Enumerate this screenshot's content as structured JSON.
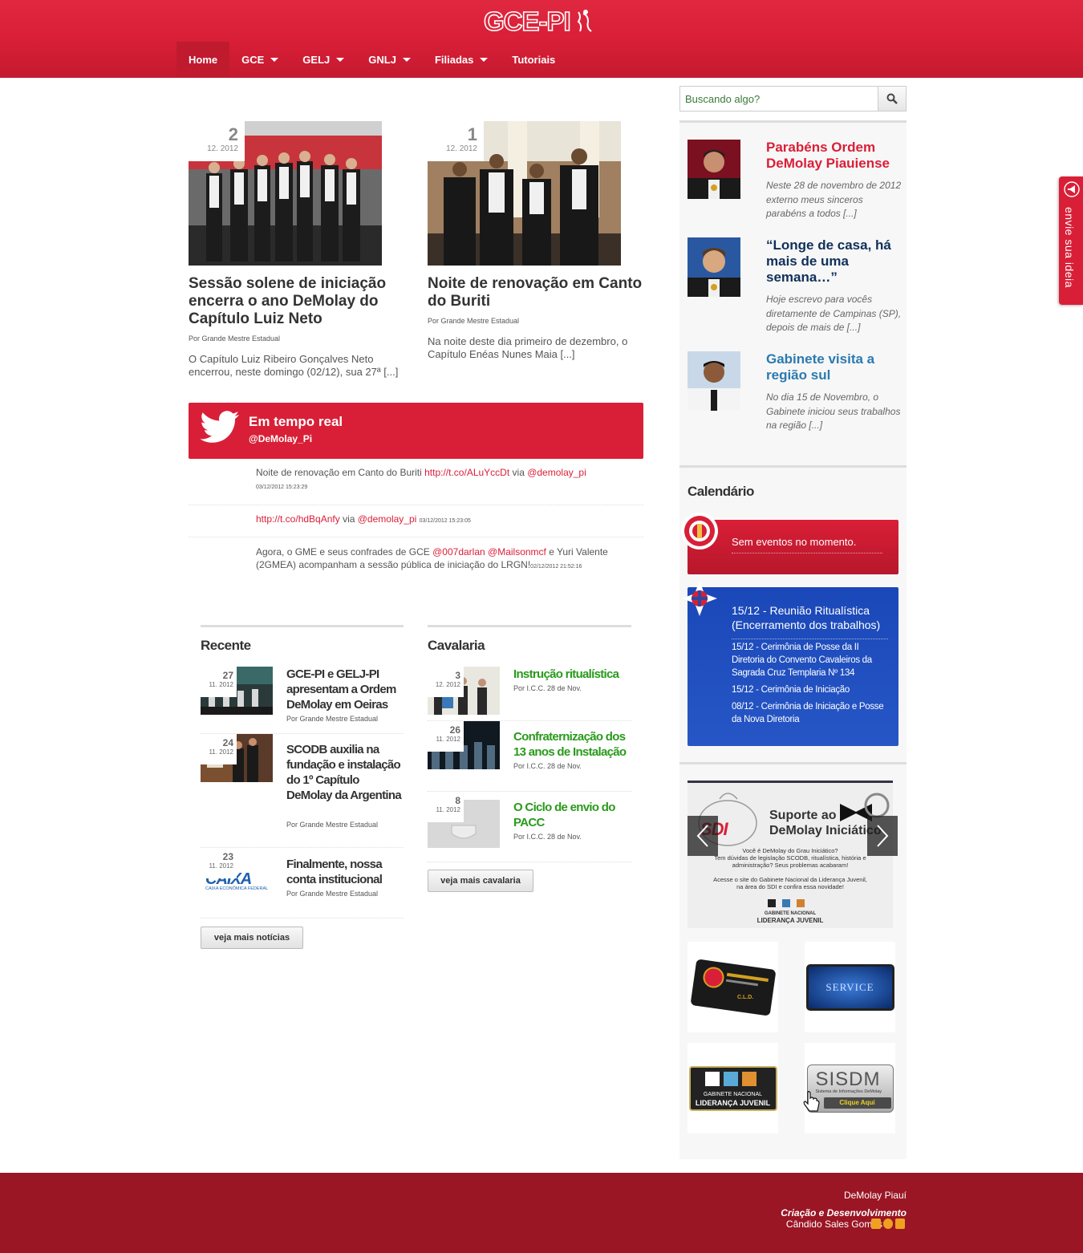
{
  "header": {
    "logo_text": "GCE-PI",
    "nav": [
      {
        "label": "Home",
        "active": true,
        "dropdown": false
      },
      {
        "label": "GCE",
        "dropdown": true
      },
      {
        "label": "GELJ",
        "dropdown": true
      },
      {
        "label": "GNLJ",
        "dropdown": true
      },
      {
        "label": "Filiadas",
        "dropdown": true
      },
      {
        "label": "Tutoriais",
        "dropdown": false
      }
    ]
  },
  "search": {
    "placeholder": "Buscando algo?",
    "button_icon": "search-icon"
  },
  "featured": [
    {
      "day": "2",
      "month": "12. 2012",
      "title": "Sessão solene de iniciação encerra o ano DeMolay do Capítulo Luiz Neto",
      "byline": "Por Grande Mestre Estadual",
      "excerpt": "O Capítulo Luiz Ribeiro Gonçalves Neto encerrou, neste domingo (02/12), sua 27ª [...]"
    },
    {
      "day": "1",
      "month": "12. 2012",
      "title": "Noite de renovação em Canto do Buriti",
      "byline": "Por Grande Mestre Estadual",
      "excerpt": "Na noite deste dia primeiro de dezembro, o Capítulo Enéas Nunes Maia [...]"
    }
  ],
  "twitter": {
    "title": "Em tempo real",
    "handle": "@DeMolay_Pi",
    "tweets": [
      {
        "text": "Noite de renovação em Canto do Buriti ",
        "link": "http://t.co/ALuYccDt",
        "via": " via ",
        "mention": "@demolay_pi",
        "extra": "",
        "extra_mention2": "",
        "text2": "",
        "time": "03/12/2012 15:23:29"
      },
      {
        "text": "",
        "link": "http://t.co/hdBqAnfy",
        "via": " via ",
        "mention": "@demolay_pi",
        "time": "03/12/2012 15:23:05"
      },
      {
        "text": "Agora, o GME e seus confrades de GCE ",
        "mention": "@007darlan",
        "mention2": "@Mailsonmcf",
        "text2": " e Yuri Valente (2GMEA) acompanham a sessão pública de iniciação do LRGN!",
        "time": "02/12/2012 21:52:16"
      }
    ]
  },
  "recente": {
    "title": "Recente",
    "items": [
      {
        "day": "27",
        "month": "11. 2012",
        "title": "GCE-PI e GELJ-PI apresentam a Ordem DeMolay em Oeiras",
        "byline": "Por Grande Mestre Estadual"
      },
      {
        "day": "24",
        "month": "11. 2012",
        "title": "SCODB auxilia na fundação e instalação do 1º Capítulo DeMolay da Argentina",
        "byline": "Por Grande Mestre Estadual"
      },
      {
        "day": "23",
        "month": "11. 2012",
        "title": "Finalmente, nossa conta institucional",
        "byline": "Por Grande Mestre Estadual",
        "thumb_text": "CAIXA",
        "thumb_sub": "CAIXA ECONÔMICA FEDERAL"
      }
    ],
    "more": "veja mais notícias"
  },
  "cavalaria": {
    "title": "Cavalaria",
    "items": [
      {
        "day": "3",
        "month": "12. 2012",
        "title": "Instrução ritualística",
        "byline": "Por I.C.C. 28 de Nov."
      },
      {
        "day": "26",
        "month": "11. 2012",
        "title": "Confraternização dos 13 anos de Instalação",
        "byline": "Por I.C.C. 28 de Nov."
      },
      {
        "day": "8",
        "month": "11. 2012",
        "title": "O Ciclo de envio do PACC",
        "byline": "Por I.C.C. 28 de Nov."
      }
    ],
    "more": "veja mais cavalaria"
  },
  "sidebar": {
    "posts": [
      {
        "title": "Parabéns Ordem DeMolay Piauiense",
        "excerpt": "Neste 28 de novembro de 2012 externo meus sinceros parabéns a todos [...]",
        "color": "#d91f37"
      },
      {
        "title": "“Longe de casa, há mais de uma semana…”",
        "excerpt": "Hoje escrevo para vocês diretamente de Campinas (SP), depois de mais de [...]",
        "color": "#10305a"
      },
      {
        "title": "Gabinete visita a região sul",
        "excerpt": "No dia 15 de Novembro, o Gabinete iniciou seus trabalhos na região [...]",
        "color": "#2a7ab0"
      }
    ],
    "calendar_title": "Calendário",
    "calendar_empty": "Sem eventos no momento.",
    "events": [
      "15/12 - Reunião Ritualística (Encerramento dos trabalhos)",
      "15/12 - Cerimônia de Posse da II Diretoria do Convento Cavaleiros da Sagrada Cruz Templaria Nº 134",
      "15/12 - Cerimônia de Iniciação",
      "08/12 - Cerimônia de Iniciação e Posse da Nova Diretoria"
    ],
    "banner": {
      "badge": "SDI",
      "headline1": "Suporte ao",
      "headline2": "DeMolay Iniciático",
      "body1": "Você é DeMolay do Grau Iniciático?",
      "body2": "Tem dúvidas de legislação SCODB, ritualística, história e administração? Seus problemas acabaram!",
      "body3": "Acesse o site do Gabinete Nacional da Liderança Juvenil, na área do SDI e confira essa novidade!",
      "footer1": "GABINETE NACIONAL",
      "footer2": "LIDERANÇA JUVENIL"
    },
    "partners": [
      {
        "name": "card-partner",
        "text": "C.L.D."
      },
      {
        "name": "service-partner",
        "text": "SERVICE"
      },
      {
        "name": "gnlj-partner",
        "text1": "GABINETE NACIONAL",
        "text2": "LIDERANÇA JUVENIL"
      },
      {
        "name": "sisdm-partner",
        "text1": "SISDM",
        "text2": "Sistema de Informações DeMolay",
        "text3": "Clique Aqui"
      }
    ]
  },
  "sidetab": {
    "label": "envie sua ideia"
  },
  "footer": {
    "site": "DeMolay Piauí",
    "credit": "Criação e Desenvolvimento",
    "author": "Cândido Sales Gomes"
  }
}
